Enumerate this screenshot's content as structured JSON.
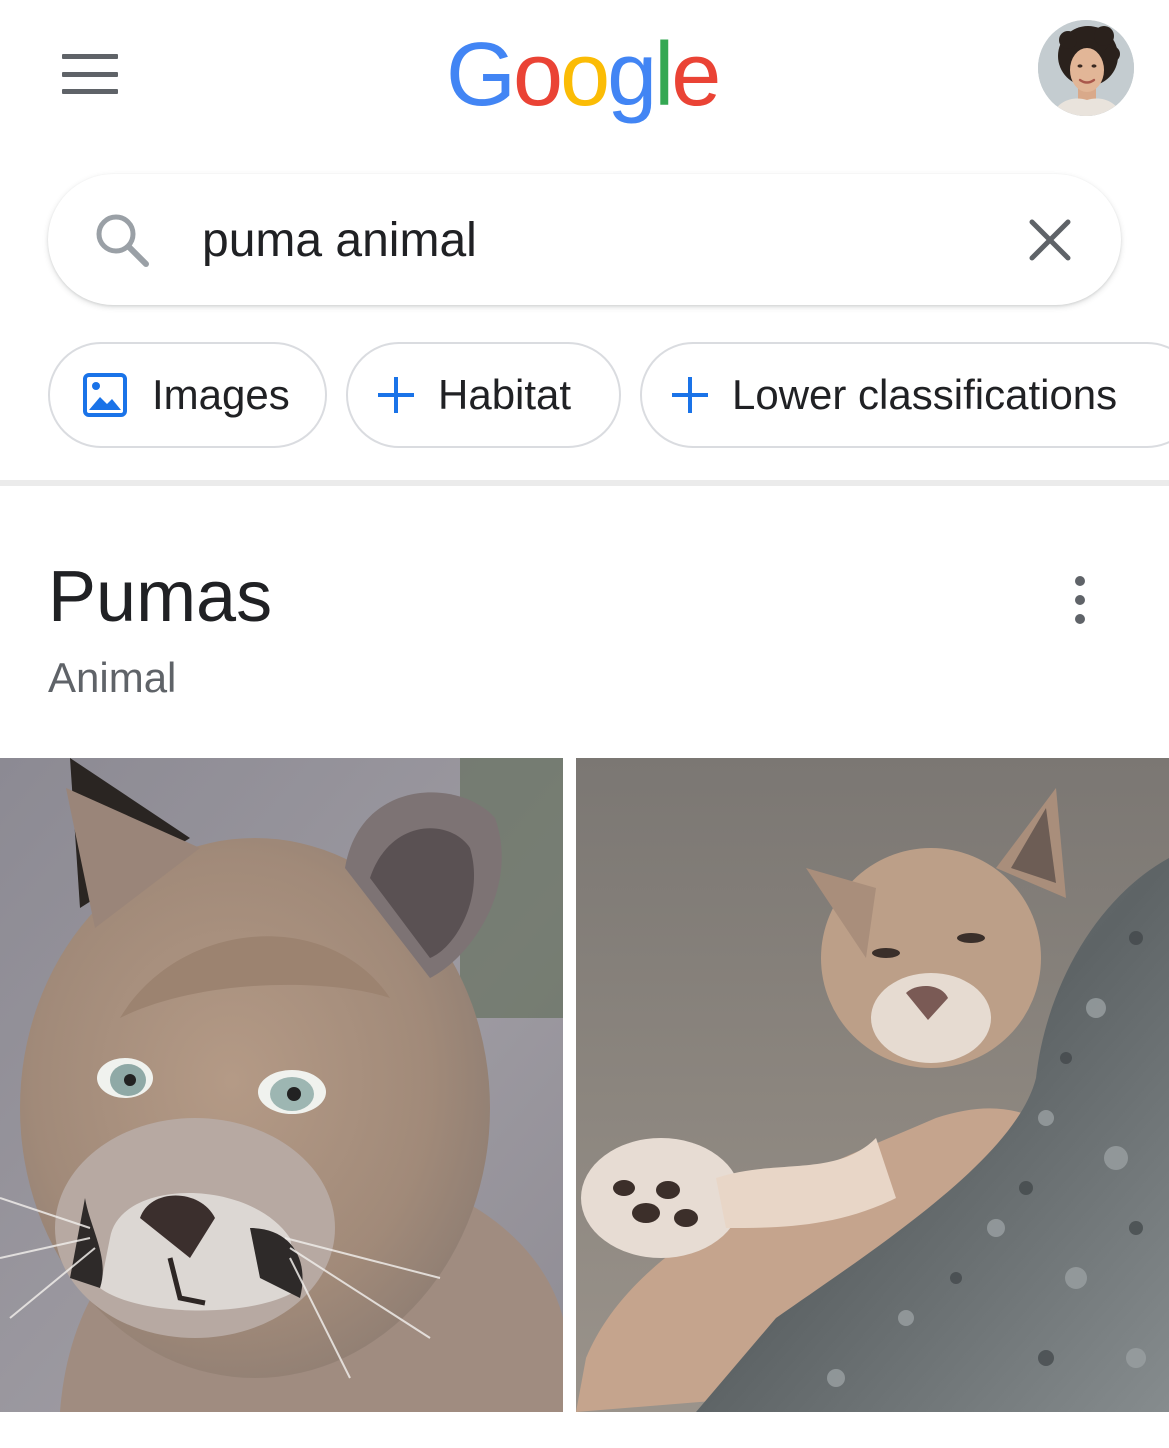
{
  "header": {
    "menu_icon": "hamburger-menu-icon",
    "logo": [
      "G",
      "o",
      "o",
      "g",
      "l",
      "e"
    ],
    "brand_colors": {
      "blue": "#4285F4",
      "red": "#EA4335",
      "yellow": "#FBBC05",
      "green": "#34A853"
    },
    "avatar_icon": "user-avatar"
  },
  "search": {
    "query": "puma animal",
    "search_icon": "search-icon",
    "clear_icon": "close-icon"
  },
  "chips": [
    {
      "label": "Images",
      "icon": "image-icon"
    },
    {
      "label": "Habitat",
      "icon": "plus-icon"
    },
    {
      "label": "Lower classifications",
      "icon": "plus-icon"
    }
  ],
  "knowledge_panel": {
    "title": "Pumas",
    "subtitle": "Animal",
    "more_icon": "more-vert-icon",
    "images": [
      "puma-face-photo",
      "puma-lying-on-rock-photo"
    ]
  },
  "colors": {
    "text_primary": "#202124",
    "text_secondary": "#5f6368",
    "chip_border": "#dadce0",
    "accent": "#1a73e8"
  }
}
